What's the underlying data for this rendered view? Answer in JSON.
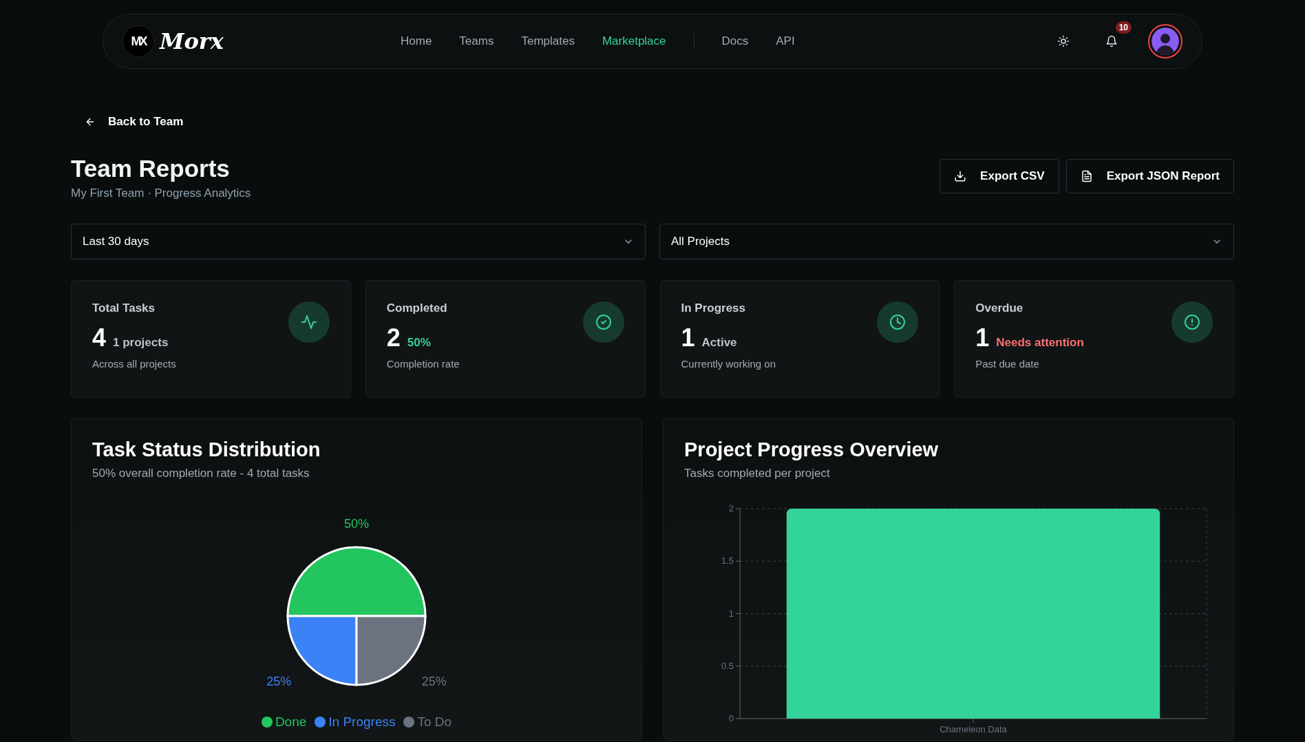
{
  "navbar": {
    "logo_mark": "MX",
    "logo_text": "Morx",
    "links": [
      {
        "label": "Home",
        "selected": false
      },
      {
        "label": "Teams",
        "selected": false
      },
      {
        "label": "Templates",
        "selected": false
      },
      {
        "label": "Marketplace",
        "selected": true
      }
    ],
    "secondary_links": [
      {
        "label": "Docs",
        "selected": false
      },
      {
        "label": "API",
        "selected": false
      }
    ],
    "notification_count": "10"
  },
  "back_link": "Back to Team",
  "header": {
    "title": "Team Reports",
    "subtitle": "My First Team · Progress Analytics",
    "actions": [
      {
        "label": "Export CSV",
        "kind": "download"
      },
      {
        "label": "Export JSON Report",
        "kind": "document"
      }
    ]
  },
  "filters": [
    {
      "value": "Last 30 days"
    },
    {
      "value": "All Projects"
    }
  ],
  "stats": [
    {
      "label": "Total Tasks",
      "value": "4",
      "note": "1 projects",
      "caption": "Across all projects",
      "kind": "total"
    },
    {
      "label": "Completed",
      "value": "2",
      "note": "50%",
      "caption": "Completion rate",
      "kind": "completed"
    },
    {
      "label": "In Progress",
      "value": "1",
      "note": "Active",
      "caption": "Currently working on",
      "kind": "in_progress"
    },
    {
      "label": "Overdue",
      "value": "1",
      "note": "Needs attention",
      "caption": "Past due date",
      "kind": "overdue"
    }
  ],
  "charts": [
    {
      "title": "Task Status Distribution",
      "subtitle": "50% overall completion rate - 4 total tasks",
      "chart_data": {
        "type": "pie",
        "categories": [
          "Done",
          "In Progress",
          "To Do"
        ],
        "values": [
          50,
          25,
          25
        ],
        "colors": [
          "#22c55e",
          "#3b82f6",
          "#6b7280"
        ],
        "value_labels": [
          "50%",
          "25%",
          "25%"
        ],
        "legend": "bottom"
      }
    },
    {
      "title": "Project Progress Overview",
      "subtitle": "Tasks completed per project",
      "chart_data": {
        "type": "bar",
        "categories": [
          "Chameleon Data"
        ],
        "series": [
          {
            "color": "#34d399",
            "values": [
              2
            ]
          }
        ],
        "ylim": [
          0,
          2
        ],
        "yticks": [
          0,
          0.5,
          1,
          1.5,
          2
        ],
        "grid": true
      }
    }
  ]
}
